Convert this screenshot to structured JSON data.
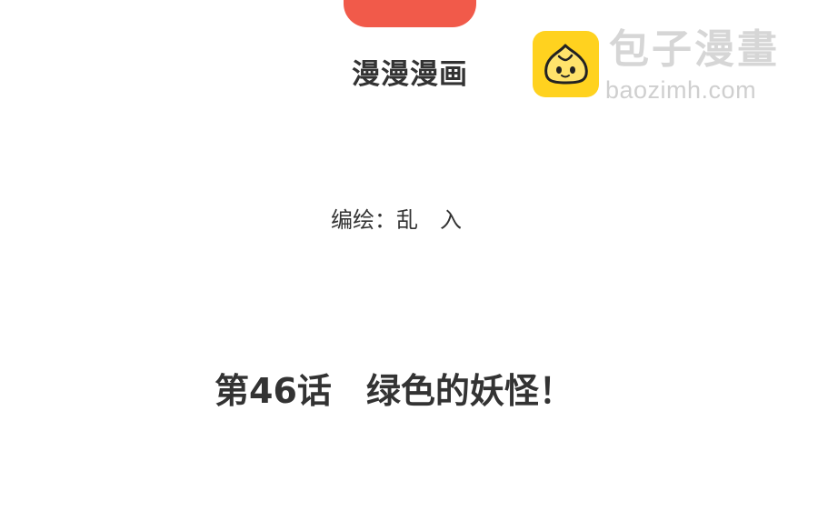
{
  "header": {
    "app_name": "漫漫漫画"
  },
  "watermark": {
    "title": "包子漫畫",
    "url": "baozimh.com",
    "icon": "bun-mascot-icon",
    "accent": "#ffd21f"
  },
  "credit": {
    "text": "编绘：乱　入"
  },
  "chapter": {
    "title": "第46话　绿色的妖怪！"
  }
}
